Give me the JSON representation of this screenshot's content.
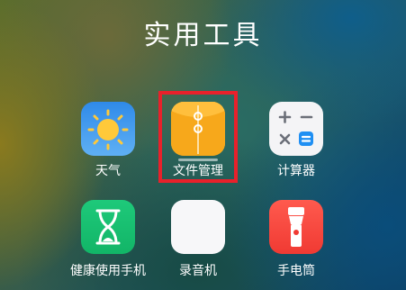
{
  "folder": {
    "title": "实用工具"
  },
  "apps": [
    {
      "label": "天气",
      "icon": "sun-icon"
    },
    {
      "label": "文件管理",
      "icon": "folder-icon"
    },
    {
      "label": "计算器",
      "icon": "calculator-icon"
    },
    {
      "label": "健康使用手机",
      "icon": "hourglass-icon"
    },
    {
      "label": "录音机",
      "icon": "sound-wave-icon"
    },
    {
      "label": "手电筒",
      "icon": "flashlight-icon"
    }
  ],
  "colors": {
    "highlight_border": "#e8212b",
    "weather_bg": "#2f8ae9",
    "files_bg": "#f7a81b",
    "health_bg": "#1ec97a",
    "torch_bg": "#f03a33",
    "calc_operator": "#6b6f78",
    "calc_equals": "#1f8ff3"
  }
}
